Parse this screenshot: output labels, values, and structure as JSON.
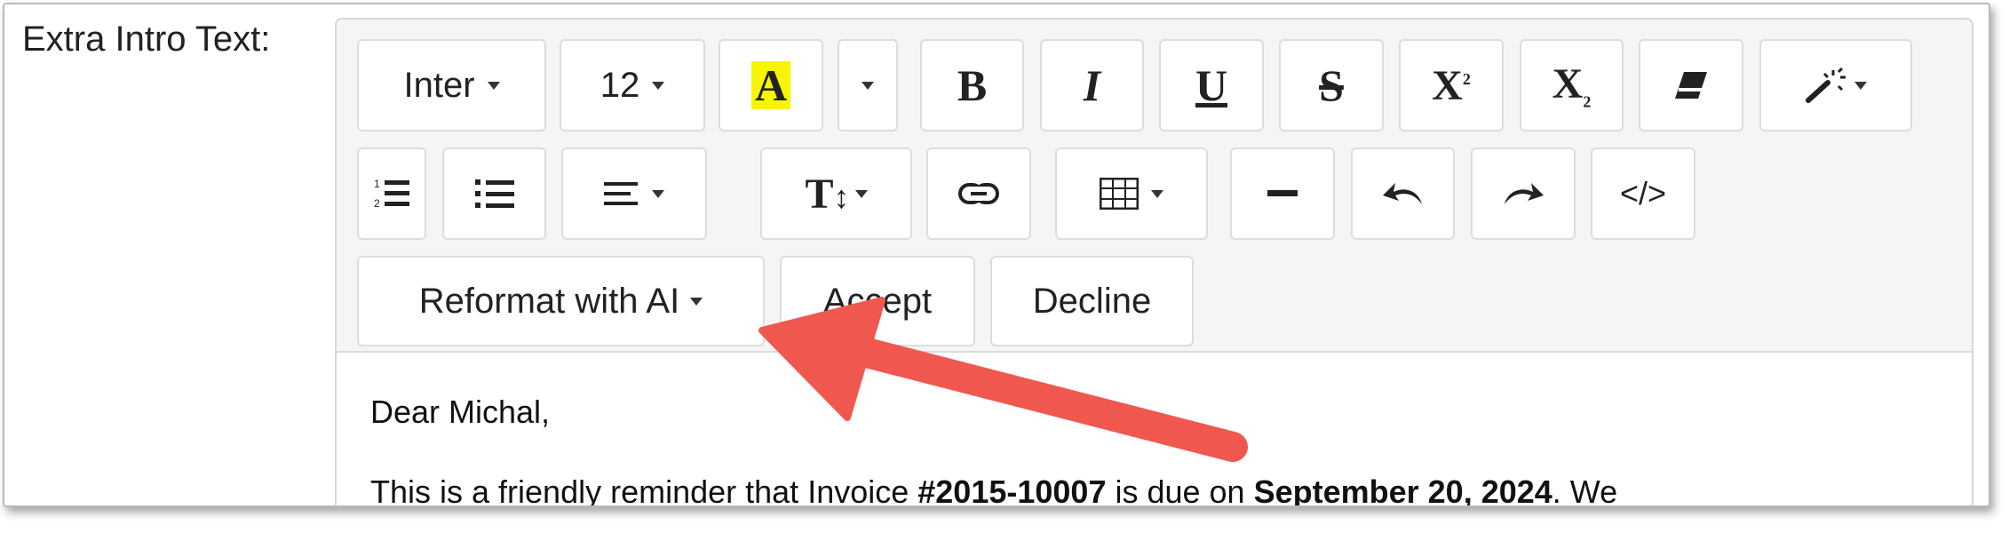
{
  "field": {
    "label": "Extra Intro Text:"
  },
  "toolbar": {
    "font_family": "Inter",
    "font_size": "12",
    "highlight_letter": "A",
    "bold": "B",
    "italic": "I",
    "underline": "U",
    "strike": "S",
    "superscript_letter": "X",
    "superscript_mark": "2",
    "subscript_letter": "X",
    "subscript_mark": "2",
    "style_letter": "T",
    "code": "</>",
    "reformat_ai": "Reformat with AI",
    "accept": "Accept",
    "decline": "Decline"
  },
  "content": {
    "greeting": "Dear Michal,",
    "line_prefix": "This is a friendly reminder that Invoice ",
    "invoice_no": "#2015-10007",
    "line_mid": " is due on ",
    "due_date": "September 20, 2024",
    "line_suffix": ". We"
  },
  "colors": {
    "highlight": "#f7f500",
    "annotation_arrow": "#f0584f"
  },
  "icons": [
    "caret-down-icon",
    "highlight-color-icon",
    "eraser-icon",
    "magic-wand-icon",
    "ordered-list-icon",
    "unordered-list-icon",
    "align-icon",
    "text-style-icon",
    "link-icon",
    "table-icon",
    "horizontal-rule-icon",
    "undo-icon",
    "redo-icon",
    "code-view-icon",
    "arrow-annotation-icon"
  ]
}
